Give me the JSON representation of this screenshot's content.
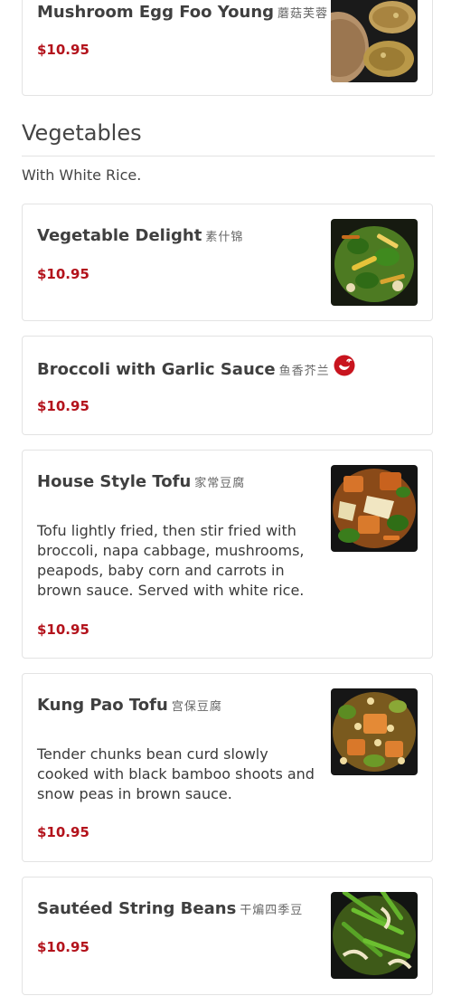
{
  "top_item": {
    "name": "Mushroom Egg Foo Young",
    "name_cn": "蘑菇芙蓉",
    "price": "$10.95"
  },
  "section": {
    "title": "Vegetables",
    "note": "With White Rice."
  },
  "items": [
    {
      "name": "Vegetable Delight",
      "name_cn": "素什锦",
      "price": "$10.95",
      "description": "",
      "has_image": true,
      "spicy": false
    },
    {
      "name": "Broccoli with Garlic Sauce",
      "name_cn": "鱼香芥兰",
      "price": "$10.95",
      "description": "",
      "has_image": false,
      "spicy": true
    },
    {
      "name": "House Style Tofu",
      "name_cn": "家常豆腐",
      "price": "$10.95",
      "description": "Tofu lightly fried, then stir fried with broccoli, napa cabbage, mushrooms, peapods, baby corn and carrots in brown sauce. Served with white rice.",
      "has_image": true,
      "spicy": false
    },
    {
      "name": "Kung Pao Tofu",
      "name_cn": "宫保豆腐",
      "price": "$10.95",
      "description": "Tender chunks bean curd slowly cooked with black bamboo shoots and snow peas in brown sauce.",
      "has_image": true,
      "spicy": false
    },
    {
      "name": "Sautéed String Beans",
      "name_cn": "干煸四季豆",
      "price": "$10.95",
      "description": "",
      "has_image": true,
      "spicy": false
    }
  ],
  "colors": {
    "price": "#b3121b",
    "spicy_icon": "#c8141e",
    "border": "#e3e3e3"
  },
  "icons": {
    "spicy": "chili-pepper-icon"
  }
}
